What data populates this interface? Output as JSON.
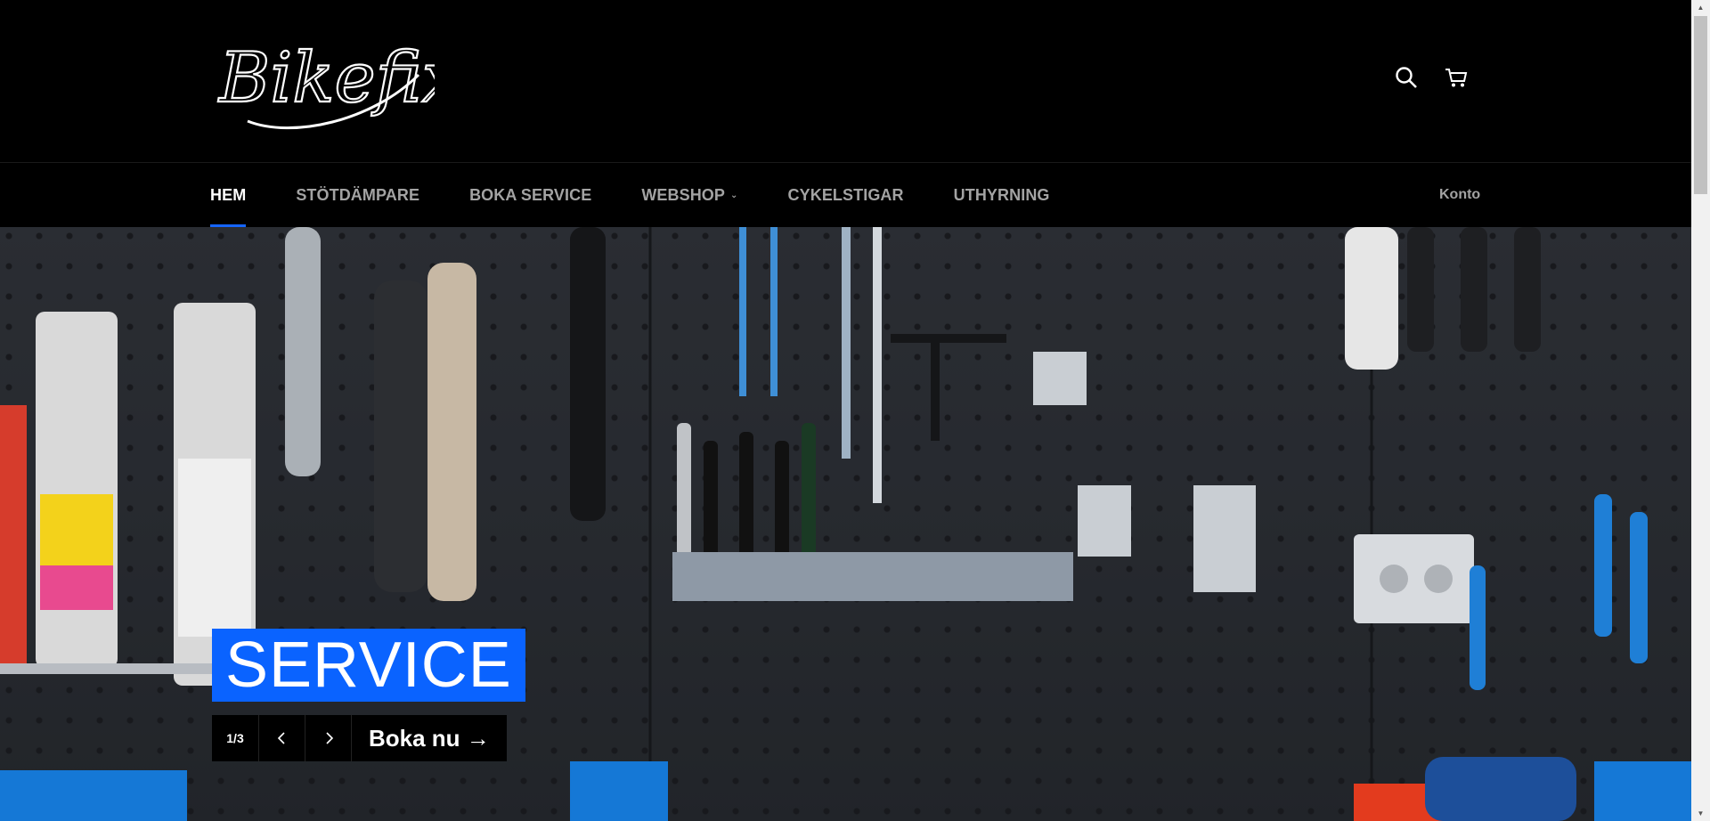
{
  "header": {
    "logo_text": "Bikefix",
    "icons": [
      "search-icon",
      "cart-icon"
    ]
  },
  "nav": {
    "items": [
      {
        "label": "HEM",
        "active": true
      },
      {
        "label": "STÖTDÄMPARE"
      },
      {
        "label": "BOKA SERVICE"
      },
      {
        "label": "WEBSHOP",
        "has_dropdown": true
      },
      {
        "label": "CYKELSTIGAR"
      },
      {
        "label": "UTHYRNING"
      }
    ],
    "account_label": "Konto"
  },
  "hero": {
    "title": "SERVICE",
    "counter": "1/3",
    "cta_label": "Boka nu →"
  },
  "colors": {
    "accent": "#0a63ff",
    "background": "#000000",
    "nav_inactive": "#a3a3a3"
  }
}
